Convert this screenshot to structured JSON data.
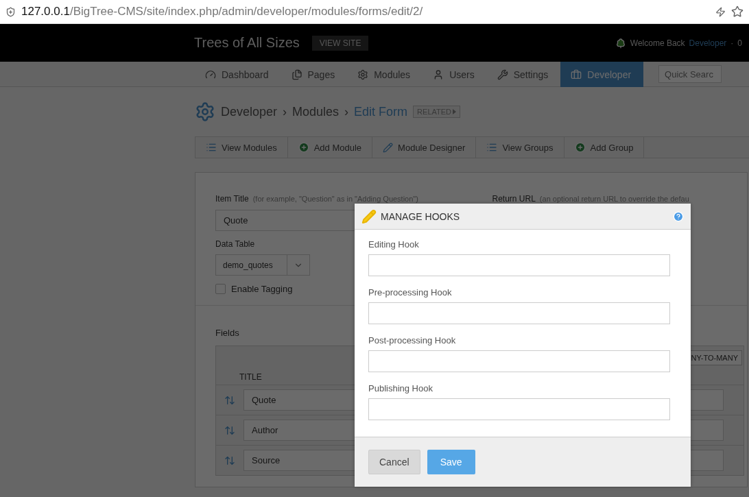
{
  "browser": {
    "url_host": "127.0.0.1",
    "url_path": "/BigTree-CMS/site/index.php/admin/developer/modules/forms/edit/2/"
  },
  "header": {
    "site_title": "Trees of All Sizes",
    "view_site": "VIEW SITE",
    "welcome": "Welcome Back",
    "user": "Developer",
    "separator": "·",
    "messages": "0"
  },
  "nav": {
    "items": [
      {
        "label": "Dashboard",
        "selected": false
      },
      {
        "label": "Pages",
        "selected": false
      },
      {
        "label": "Modules",
        "selected": false
      },
      {
        "label": "Users",
        "selected": false
      },
      {
        "label": "Settings",
        "selected": false
      },
      {
        "label": "Developer",
        "selected": true
      }
    ],
    "search": {
      "placeholder": "Quick Searc"
    }
  },
  "breadcrumb": {
    "items": [
      "Developer",
      "Modules",
      "Edit Form"
    ],
    "separator": "›",
    "related": "RELATED"
  },
  "subnav": [
    {
      "label": "View Modules"
    },
    {
      "label": "Add Module"
    },
    {
      "label": "Module Designer"
    },
    {
      "label": "View Groups"
    },
    {
      "label": "Add Group"
    }
  ],
  "form": {
    "item_title": {
      "label": "Item Title",
      "hint": "(for example, \"Question\" as in \"Adding Question\")",
      "value": "Quote"
    },
    "return_url": {
      "label": "Return URL",
      "hint": "(an optional return URL to override the defau"
    },
    "data_table": {
      "label": "Data Table",
      "value": "demo_quotes"
    },
    "tagging": {
      "label": "Enable Tagging",
      "checked": false
    }
  },
  "fields": {
    "label": "Fields",
    "add_button": "NY-TO-MANY",
    "column": "TITLE",
    "rows": [
      "Quote",
      "Author",
      "Source"
    ]
  },
  "modal": {
    "title": "MANAGE HOOKS",
    "fields": [
      {
        "label": "Editing Hook"
      },
      {
        "label": "Pre-processing Hook"
      },
      {
        "label": "Post-processing Hook"
      },
      {
        "label": "Publishing Hook"
      }
    ],
    "buttons": [
      {
        "label": "Cancel",
        "kind": "secondary"
      },
      {
        "label": "Save",
        "kind": "primary"
      }
    ]
  }
}
